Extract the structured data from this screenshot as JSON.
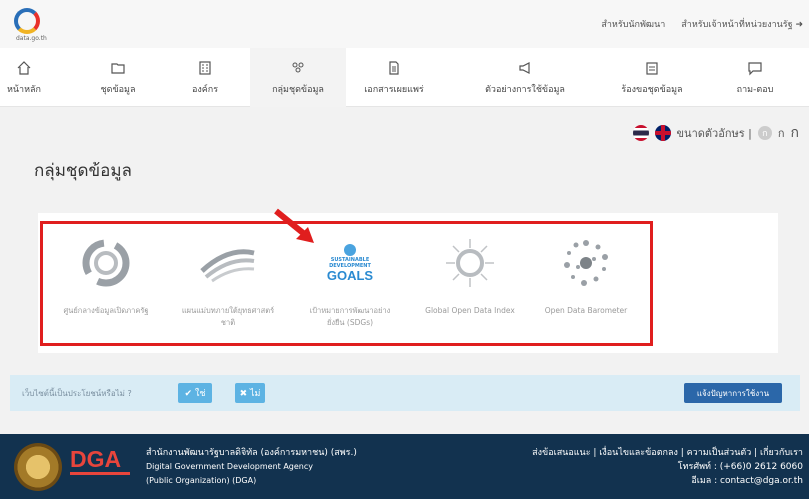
{
  "header": {
    "logo_text": "data.go.th",
    "links": [
      "สำหรับนักพัฒนา",
      "สำหรับเจ้าหน้าที่หน่วยงานรัฐ ➜"
    ]
  },
  "nav": {
    "items": [
      {
        "label": "หน้าหลัก",
        "icon": "home-icon"
      },
      {
        "label": "ชุดข้อมูล",
        "icon": "folder-icon"
      },
      {
        "label": "องค์กร",
        "icon": "building-icon"
      },
      {
        "label": "กลุ่มชุดข้อมูล",
        "icon": "group-icon",
        "active": true
      },
      {
        "label": "เอกสารเผยแพร่",
        "icon": "document-icon"
      },
      {
        "label": "ตัวอย่างการใช้ข้อมูล",
        "icon": "megaphone-icon"
      },
      {
        "label": "ร้องขอชุดข้อมูล",
        "icon": "request-icon"
      },
      {
        "label": "ถาม-ตอบ",
        "icon": "chat-icon"
      }
    ]
  },
  "lang": {
    "font_size_label": "ขนาดตัวอักษร |",
    "sizes": [
      "ก",
      "ก",
      "ก"
    ]
  },
  "page_title": "กลุ่มชุดข้อมูล",
  "groups": [
    {
      "label": "ศูนย์กลางข้อมูลเปิดภาครัฐ",
      "icon": "open-data-icon"
    },
    {
      "label": "แผนแม่บทภายใต้ยุทธศาสตร์ชาติ",
      "icon": "wave-icon"
    },
    {
      "label": "เป้าหมายการพัฒนาอย่างยั่งยืน (SDGs)",
      "icon": "sdgs-logo-icon",
      "logo_lines": [
        "SUSTAINABLE",
        "DEVELOPMENT",
        "GOALS"
      ]
    },
    {
      "label": "Global Open Data Index",
      "icon": "burst-icon"
    },
    {
      "label": "Open Data Barometer",
      "icon": "dots-circle-icon"
    }
  ],
  "feedback": {
    "question": "เว็บไซต์นี้เป็นประโยชน์หรือไม่ ?",
    "yes_label": "✔ ใช่",
    "no_label": "✖ ไม่",
    "report_label": "แจ้งปัญหาการใช้งาน"
  },
  "footer": {
    "logo": "DGA",
    "org_lines": [
      "สำนักงานพัฒนารัฐบาลดิจิทัล (องค์การมหาชน) (สพร.)",
      "Digital Government Development Agency",
      "(Public Organization) (DGA)"
    ],
    "contact_lines": [
      "ส่งข้อเสนอแนะ | เงื่อนไขและข้อตกลง | ความเป็นส่วนตัว | เกี่ยวกับเรา",
      "โทรศัพท์ : (+66)0 2612 6060",
      "อีเมล : contact@dga.or.th"
    ]
  },
  "colors": {
    "accent": "#2b67a9",
    "highlight_box": "#e01e1e",
    "footer_bg": "#12324f"
  }
}
